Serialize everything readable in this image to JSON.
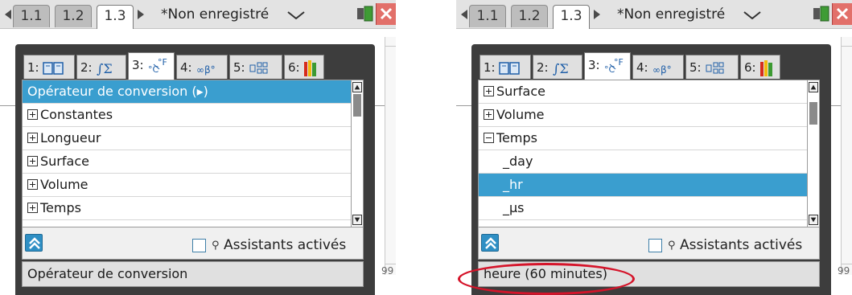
{
  "left": {
    "topbar": {
      "tabs": [
        "1.1",
        "1.2",
        "1.3"
      ],
      "active_tab": "1.3",
      "doc_title": "*Non enregistré"
    },
    "catalog": {
      "tabs": [
        {
          "num": "1:",
          "icon": "book-icon"
        },
        {
          "num": "2:",
          "icon": "integral-sigma-icon"
        },
        {
          "num": "3:",
          "icon": "units-degree-icon"
        },
        {
          "num": "4:",
          "icon": "infinity-beta-icon"
        },
        {
          "num": "5:",
          "icon": "template-icon"
        },
        {
          "num": "6:",
          "icon": "library-icon"
        }
      ],
      "active_tab": 3,
      "items": [
        {
          "label": "Opérateur de conversion (▸)",
          "kind": "plain",
          "selected": true
        },
        {
          "label": "Constantes",
          "kind": "collapsed",
          "selected": false
        },
        {
          "label": "Longueur",
          "kind": "collapsed",
          "selected": false
        },
        {
          "label": "Surface",
          "kind": "collapsed",
          "selected": false
        },
        {
          "label": "Volume",
          "kind": "collapsed",
          "selected": false
        },
        {
          "label": "Temps",
          "kind": "collapsed",
          "selected": false
        }
      ],
      "wizard_label": "Assistants activés",
      "wizard_checked": false,
      "help_text": "Opérateur de conversion"
    },
    "page_number_hint": "99"
  },
  "right": {
    "topbar": {
      "tabs": [
        "1.1",
        "1.2",
        "1.3"
      ],
      "active_tab": "1.3",
      "doc_title": "*Non enregistré"
    },
    "catalog": {
      "tabs": [
        {
          "num": "1:",
          "icon": "book-icon"
        },
        {
          "num": "2:",
          "icon": "integral-sigma-icon"
        },
        {
          "num": "3:",
          "icon": "units-degree-icon"
        },
        {
          "num": "4:",
          "icon": "infinity-beta-icon"
        },
        {
          "num": "5:",
          "icon": "template-icon"
        },
        {
          "num": "6:",
          "icon": "library-icon"
        }
      ],
      "active_tab": 3,
      "items": [
        {
          "label": "Surface",
          "kind": "collapsed",
          "selected": false
        },
        {
          "label": "Volume",
          "kind": "collapsed",
          "selected": false
        },
        {
          "label": "Temps",
          "kind": "expanded",
          "selected": false
        },
        {
          "label": "_day",
          "kind": "child",
          "selected": false
        },
        {
          "label": "_hr",
          "kind": "child",
          "selected": true
        },
        {
          "label": "_μs",
          "kind": "child",
          "selected": false
        }
      ],
      "wizard_label": "Assistants activés",
      "wizard_checked": false,
      "help_text": "heure (60 minutes)"
    },
    "page_number_hint": "99"
  },
  "colors": {
    "selection": "#3a9ecf",
    "dialog_frame": "#3d3d3d",
    "close_button": "#e2706a",
    "annotation_ellipse": "#d5142a"
  }
}
